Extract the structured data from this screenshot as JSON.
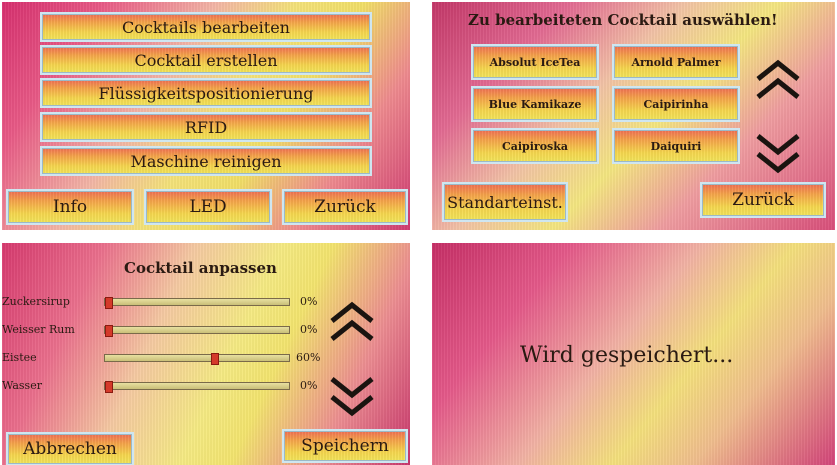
{
  "screen_main": {
    "menu": [
      "Cocktails bearbeiten",
      "Cocktail erstellen",
      "Flüssigkeitspositionierung",
      "RFID",
      "Maschine reinigen"
    ],
    "bottom": [
      "Info",
      "LED",
      "Zurück"
    ]
  },
  "screen_select": {
    "title": "Zu bearbeiteten Cocktail auswählen!",
    "cocktails": [
      "Absolut IceTea",
      "Arnold Palmer",
      "Blue Kamikaze",
      "Caipirinha",
      "Caipiroska",
      "Daiquiri"
    ],
    "defaults_label": "Standarteinst.",
    "back_label": "Zurück",
    "up_icon": "double-chevron-up-icon",
    "down_icon": "double-chevron-down-icon"
  },
  "screen_adjust": {
    "title": "Cocktail anpassen",
    "sliders": [
      {
        "label": "Zuckersirup",
        "value_text": "0%",
        "value": 0
      },
      {
        "label": "Weisser Rum",
        "value_text": "0%",
        "value": 0
      },
      {
        "label": "Eistee",
        "value_text": "60%",
        "value": 60
      },
      {
        "label": "Wasser",
        "value_text": "0%",
        "value": 0
      }
    ],
    "cancel_label": "Abbrechen",
    "save_label": "Speichern"
  },
  "screen_saving": {
    "message": "Wird gespeichert..."
  }
}
